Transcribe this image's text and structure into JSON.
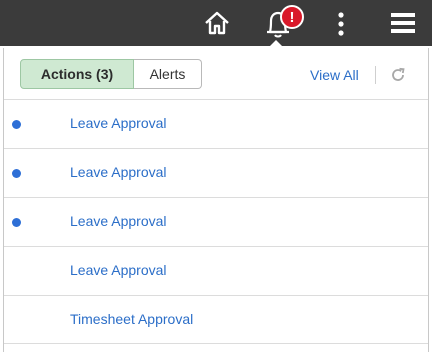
{
  "header": {
    "notification_count": "!"
  },
  "panel": {
    "tabs": [
      {
        "label": "Actions (3)",
        "active": true
      },
      {
        "label": "Alerts",
        "active": false
      }
    ],
    "view_all_label": "View All"
  },
  "items": [
    {
      "label": "Leave Approval",
      "unread": true
    },
    {
      "label": "Leave Approval",
      "unread": true
    },
    {
      "label": "Leave Approval",
      "unread": true
    },
    {
      "label": "Leave Approval",
      "unread": false
    },
    {
      "label": "Timesheet Approval",
      "unread": false
    }
  ],
  "colors": {
    "topbar": "#3b3b3b",
    "badge": "#d9192a",
    "link": "#2b6ec8",
    "active_tab": "#cfe9d2",
    "unread_dot": "#2e6fd6"
  },
  "icons": [
    "home-icon",
    "bell-icon",
    "more-vertical-icon",
    "menu-icon",
    "refresh-icon"
  ]
}
